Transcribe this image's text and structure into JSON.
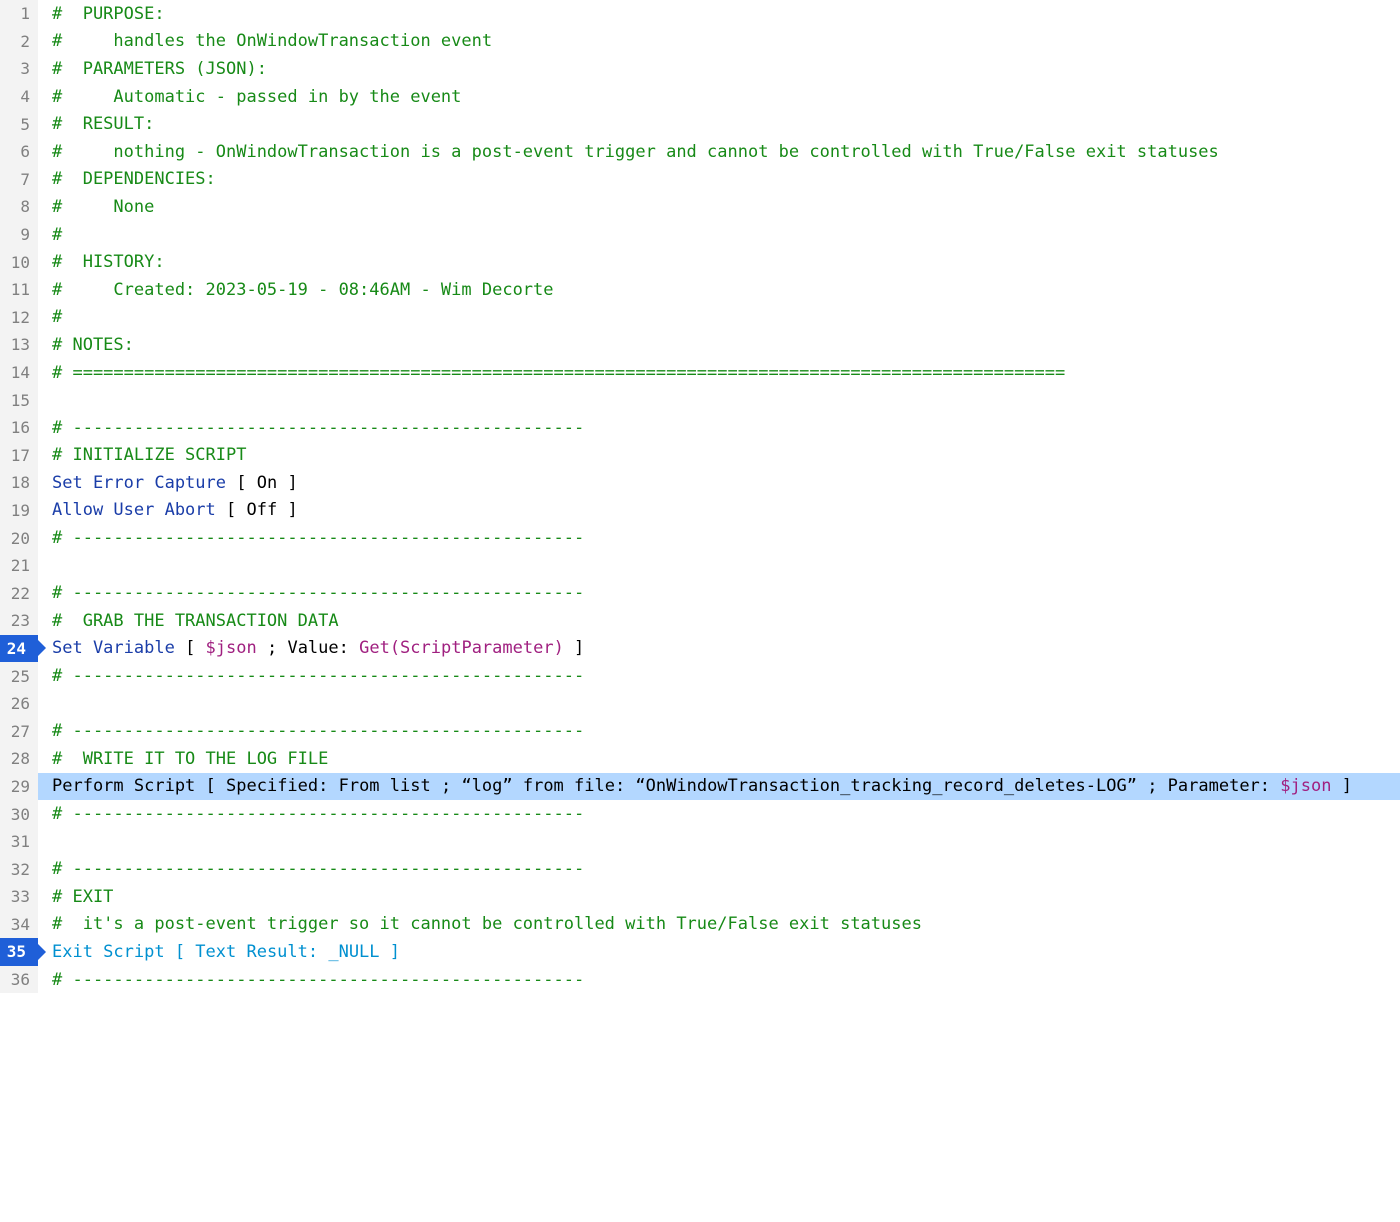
{
  "lines": [
    {
      "n": 1,
      "bp": false,
      "sel": false,
      "tokens": [
        {
          "c": "tok-comment",
          "t": "#  PURPOSE:"
        }
      ]
    },
    {
      "n": 2,
      "bp": false,
      "sel": false,
      "tokens": [
        {
          "c": "tok-comment",
          "t": "#     handles the OnWindowTransaction event"
        }
      ]
    },
    {
      "n": 3,
      "bp": false,
      "sel": false,
      "tokens": [
        {
          "c": "tok-comment",
          "t": "#  PARAMETERS (JSON):"
        }
      ]
    },
    {
      "n": 4,
      "bp": false,
      "sel": false,
      "tokens": [
        {
          "c": "tok-comment",
          "t": "#     Automatic - passed in by the event"
        }
      ]
    },
    {
      "n": 5,
      "bp": false,
      "sel": false,
      "tokens": [
        {
          "c": "tok-comment",
          "t": "#  RESULT:"
        }
      ]
    },
    {
      "n": 6,
      "bp": false,
      "sel": false,
      "tokens": [
        {
          "c": "tok-comment",
          "t": "#     nothing - OnWindowTransaction is a post-event trigger and cannot be controlled with True/False exit statuses"
        }
      ]
    },
    {
      "n": 7,
      "bp": false,
      "sel": false,
      "tokens": [
        {
          "c": "tok-comment",
          "t": "#  DEPENDENCIES:"
        }
      ]
    },
    {
      "n": 8,
      "bp": false,
      "sel": false,
      "tokens": [
        {
          "c": "tok-comment",
          "t": "#     None"
        }
      ]
    },
    {
      "n": 9,
      "bp": false,
      "sel": false,
      "tokens": [
        {
          "c": "tok-comment",
          "t": "#"
        }
      ]
    },
    {
      "n": 10,
      "bp": false,
      "sel": false,
      "tokens": [
        {
          "c": "tok-comment",
          "t": "#  HISTORY:"
        }
      ]
    },
    {
      "n": 11,
      "bp": false,
      "sel": false,
      "tokens": [
        {
          "c": "tok-comment",
          "t": "#     Created: 2023-05-19 - 08:46AM - Wim Decorte"
        }
      ]
    },
    {
      "n": 12,
      "bp": false,
      "sel": false,
      "tokens": [
        {
          "c": "tok-comment",
          "t": "#"
        }
      ]
    },
    {
      "n": 13,
      "bp": false,
      "sel": false,
      "tokens": [
        {
          "c": "tok-comment",
          "t": "# NOTES:"
        }
      ]
    },
    {
      "n": 14,
      "bp": false,
      "sel": false,
      "tokens": [
        {
          "c": "tok-comment",
          "t": "# ================================================================================================="
        }
      ]
    },
    {
      "n": 15,
      "bp": false,
      "sel": false,
      "tokens": []
    },
    {
      "n": 16,
      "bp": false,
      "sel": false,
      "tokens": [
        {
          "c": "tok-comment",
          "t": "# --------------------------------------------------"
        }
      ]
    },
    {
      "n": 17,
      "bp": false,
      "sel": false,
      "tokens": [
        {
          "c": "tok-comment",
          "t": "# INITIALIZE SCRIPT"
        }
      ]
    },
    {
      "n": 18,
      "bp": false,
      "sel": false,
      "tokens": [
        {
          "c": "tok-step",
          "t": "Set Error Capture "
        },
        {
          "c": "tok-bracket",
          "t": "[ "
        },
        {
          "c": "tok-on",
          "t": "On"
        },
        {
          "c": "tok-bracket",
          "t": " ]"
        }
      ]
    },
    {
      "n": 19,
      "bp": false,
      "sel": false,
      "tokens": [
        {
          "c": "tok-step",
          "t": "Allow User Abort "
        },
        {
          "c": "tok-bracket",
          "t": "[ "
        },
        {
          "c": "tok-on",
          "t": "Off"
        },
        {
          "c": "tok-bracket",
          "t": " ]"
        }
      ]
    },
    {
      "n": 20,
      "bp": false,
      "sel": false,
      "tokens": [
        {
          "c": "tok-comment",
          "t": "# --------------------------------------------------"
        }
      ]
    },
    {
      "n": 21,
      "bp": false,
      "sel": false,
      "tokens": []
    },
    {
      "n": 22,
      "bp": false,
      "sel": false,
      "tokens": [
        {
          "c": "tok-comment",
          "t": "# --------------------------------------------------"
        }
      ]
    },
    {
      "n": 23,
      "bp": false,
      "sel": false,
      "tokens": [
        {
          "c": "tok-comment",
          "t": "#  GRAB THE TRANSACTION DATA"
        }
      ]
    },
    {
      "n": 24,
      "bp": true,
      "sel": false,
      "tokens": [
        {
          "c": "tok-step",
          "t": "Set Variable "
        },
        {
          "c": "tok-bracket",
          "t": "[ "
        },
        {
          "c": "tok-var",
          "t": "$json"
        },
        {
          "c": "tok-bracket",
          "t": " ; "
        },
        {
          "c": "tok-on",
          "t": "Value: "
        },
        {
          "c": "tok-func",
          "t": "Get(ScriptParameter)"
        },
        {
          "c": "tok-bracket",
          "t": " ]"
        }
      ]
    },
    {
      "n": 25,
      "bp": false,
      "sel": false,
      "tokens": [
        {
          "c": "tok-comment",
          "t": "# --------------------------------------------------"
        }
      ]
    },
    {
      "n": 26,
      "bp": false,
      "sel": false,
      "tokens": []
    },
    {
      "n": 27,
      "bp": false,
      "sel": false,
      "tokens": [
        {
          "c": "tok-comment",
          "t": "# --------------------------------------------------"
        }
      ]
    },
    {
      "n": 28,
      "bp": false,
      "sel": false,
      "tokens": [
        {
          "c": "tok-comment",
          "t": "#  WRITE IT TO THE LOG FILE"
        }
      ]
    },
    {
      "n": 29,
      "bp": false,
      "sel": true,
      "tokens": [
        {
          "c": "tok-step-sel",
          "t": "Perform Script "
        },
        {
          "c": "tok-bracket",
          "t": "[ "
        },
        {
          "c": "tok-on",
          "t": "Specified: From list"
        },
        {
          "c": "tok-bracket",
          "t": " ; "
        },
        {
          "c": "tok-string",
          "t": "“log” from file: “OnWindowTransaction_tracking_record_deletes-LOG”"
        },
        {
          "c": "tok-bracket",
          "t": " ; "
        },
        {
          "c": "tok-on",
          "t": "Parameter: "
        },
        {
          "c": "tok-var",
          "t": "$json"
        },
        {
          "c": "tok-bracket",
          "t": " ]"
        }
      ]
    },
    {
      "n": 30,
      "bp": false,
      "sel": false,
      "tokens": [
        {
          "c": "tok-comment",
          "t": "# --------------------------------------------------"
        }
      ]
    },
    {
      "n": 31,
      "bp": false,
      "sel": false,
      "tokens": []
    },
    {
      "n": 32,
      "bp": false,
      "sel": false,
      "tokens": [
        {
          "c": "tok-comment",
          "t": "# --------------------------------------------------"
        }
      ]
    },
    {
      "n": 33,
      "bp": false,
      "sel": false,
      "tokens": [
        {
          "c": "tok-comment",
          "t": "# EXIT"
        }
      ]
    },
    {
      "n": 34,
      "bp": false,
      "sel": false,
      "tokens": [
        {
          "c": "tok-comment",
          "t": "#  it's a post-event trigger so it cannot be controlled with True/False exit statuses"
        }
      ]
    },
    {
      "n": 35,
      "bp": true,
      "sel": false,
      "tokens": [
        {
          "c": "tok-exit",
          "t": "Exit Script "
        },
        {
          "c": "tok-exit",
          "t": "[ Text Result: _NULL ]"
        }
      ]
    },
    {
      "n": 36,
      "bp": false,
      "sel": false,
      "tokens": [
        {
          "c": "tok-comment",
          "t": "# --------------------------------------------------"
        }
      ]
    }
  ]
}
